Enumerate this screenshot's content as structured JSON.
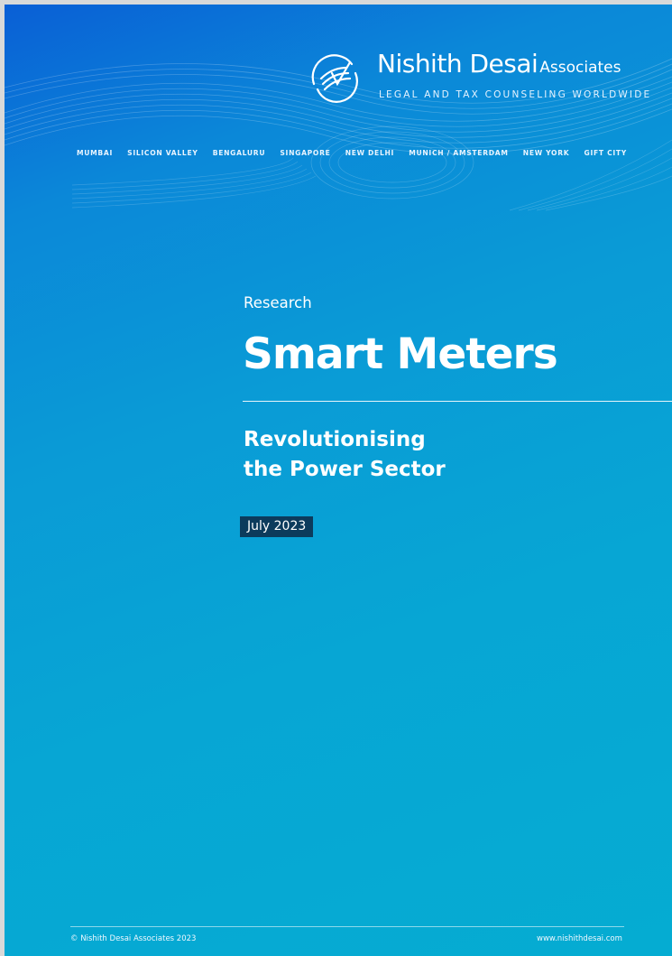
{
  "header": {
    "brand_main": "Nishith Desai",
    "brand_suffix": "Associates",
    "tagline": "LEGAL AND TAX COUNSELING WORLDWIDE",
    "logo_icon": "circular-swoosh-logo-icon",
    "cities": [
      "MUMBAI",
      "SILICON VALLEY",
      "BENGALURU",
      "SINGAPORE",
      "NEW DELHI",
      "MUNICH / AMSTERDAM",
      "NEW YORK",
      "GIFT CITY"
    ]
  },
  "cover": {
    "category": "Research",
    "title": "Smart Meters",
    "subtitle_line1": "Revolutionising",
    "subtitle_line2": "the Power Sector",
    "date": "July 2023"
  },
  "footer": {
    "copyright": "© Nishith Desai Associates 2023",
    "website": "www.nishithdesai.com"
  },
  "colors": {
    "gradient_top": "#0a5fd6",
    "gradient_bottom": "#05acd2",
    "date_badge_bg": "#0c3b5c",
    "text": "#ffffff"
  }
}
